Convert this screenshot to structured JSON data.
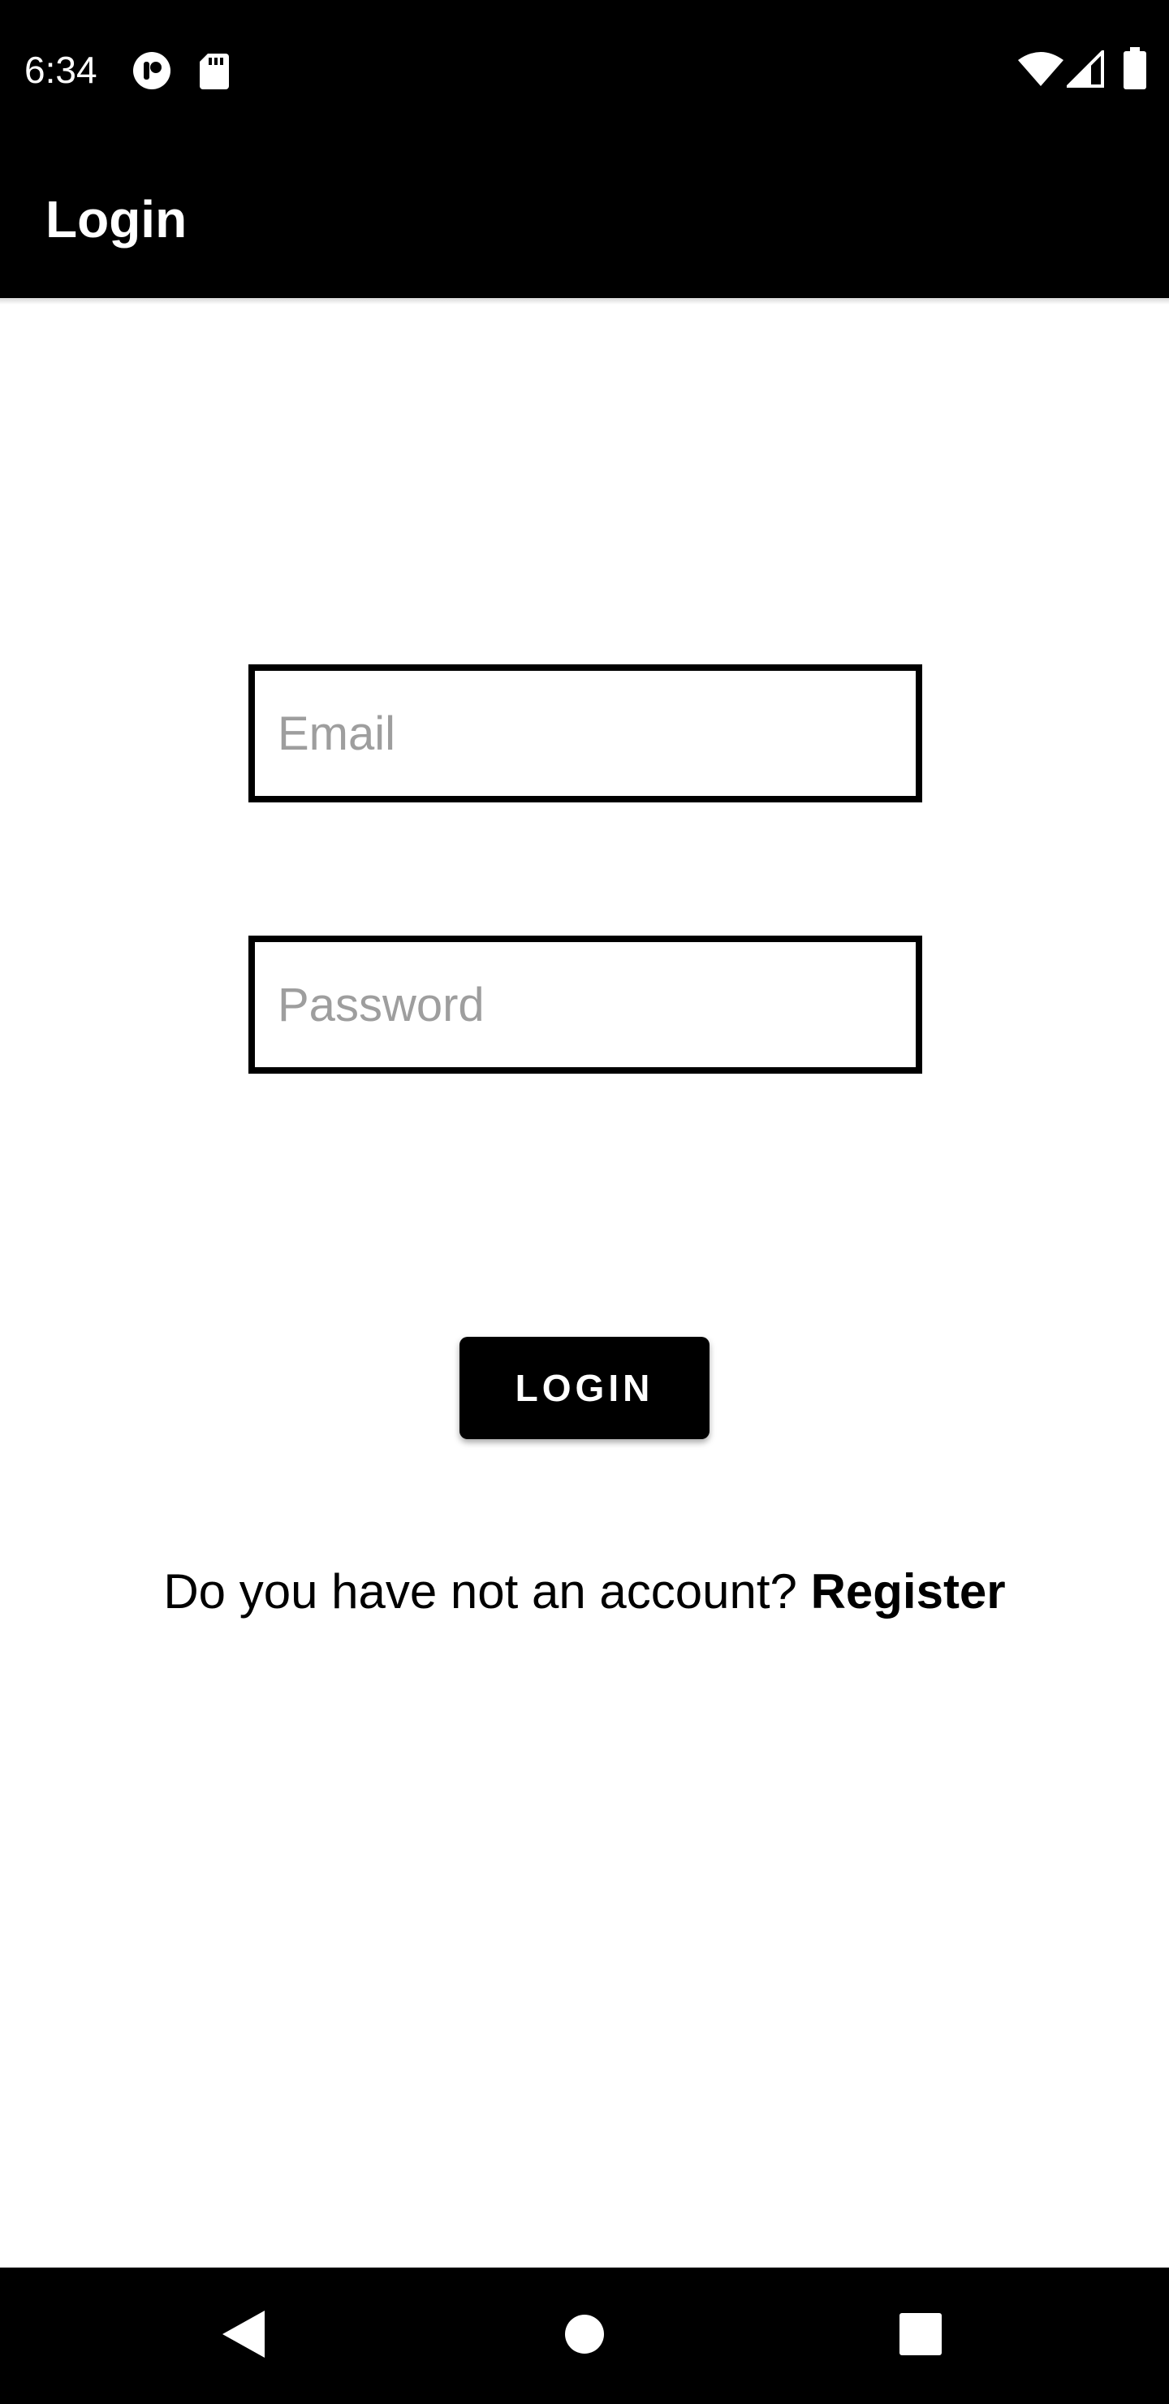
{
  "status_bar": {
    "time": "6:34",
    "left_icons": [
      "app-notification-icon",
      "sd-card-icon"
    ],
    "right_icons": [
      "wifi-icon",
      "cellular-signal-icon",
      "battery-icon"
    ]
  },
  "app_bar": {
    "title": "Login",
    "background": "#000000"
  },
  "form": {
    "email": {
      "placeholder": "Email",
      "value": ""
    },
    "password": {
      "placeholder": "Password",
      "value": ""
    },
    "login_button": {
      "label": "LOGIN"
    },
    "register_prompt": "Do you have not an account?",
    "register_link": "Register"
  },
  "nav_bar": {
    "icons": [
      "back-icon",
      "home-icon",
      "recents-icon"
    ]
  },
  "colors": {
    "accent": "#000000",
    "placeholder": "#9e9e9e",
    "background": "#ffffff"
  }
}
